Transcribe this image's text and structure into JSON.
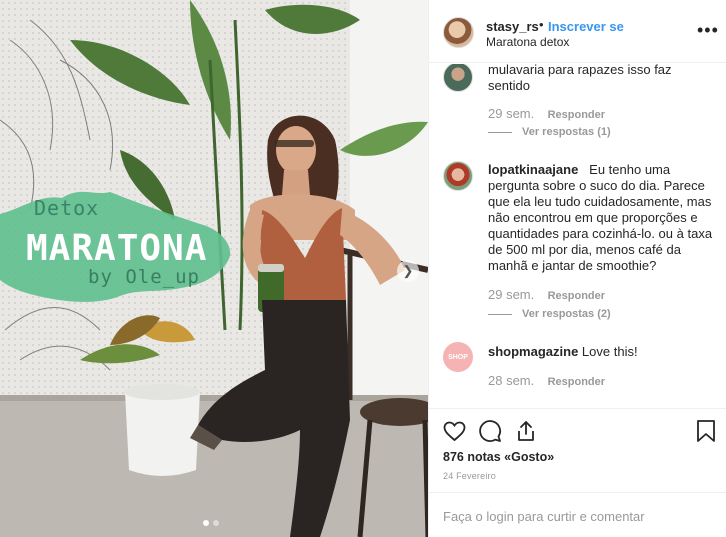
{
  "photo": {
    "overlay": {
      "subtitle": "Detox",
      "title": "MARATONA",
      "byline": "by Ole_up"
    },
    "next_icon": "chevron-right-icon",
    "carousel": {
      "total": 2,
      "active": 1
    }
  },
  "header": {
    "username": "stasy_rs",
    "separator": "•",
    "follow_label": "Inscrever se",
    "location": "Maratona detox",
    "more_icon": "more-horizontal-icon"
  },
  "comments": [
    {
      "username": "",
      "text": "mulavaria para rapazes isso faz sentido",
      "time": "29 sem.",
      "reply_label": "Responder",
      "view_replies": "Ver respostas (1)"
    },
    {
      "username": "lopatkinaajane",
      "text": "Eu tenho uma pergunta sobre o suco do dia. Parece que ela leu tudo cuidadosamente, mas não encontrou em que proporções e quantidades para cozinhá-lo. ou à taxa de 500 ml por dia, menos café da manhã e jantar de smoothie?",
      "time": "29 sem.",
      "reply_label": "Responder",
      "view_replies": "Ver respostas (2)"
    },
    {
      "username": "shopmagazine",
      "avatar_text": "SHOP",
      "text": "Love this!",
      "time": "28 sem.",
      "reply_label": "Responder"
    }
  ],
  "actions": {
    "icons": [
      "heart-icon",
      "comment-icon",
      "share-icon",
      "bookmark-icon"
    ],
    "likes": "876 notas «Gosto»",
    "date": "24 Fevereiro",
    "login_prompt": "Faça o login para curtir e comentar"
  },
  "colors": {
    "link": "#3897f0",
    "muted": "#999999",
    "text": "#262626",
    "overlay_green": "#5fbf8f"
  }
}
